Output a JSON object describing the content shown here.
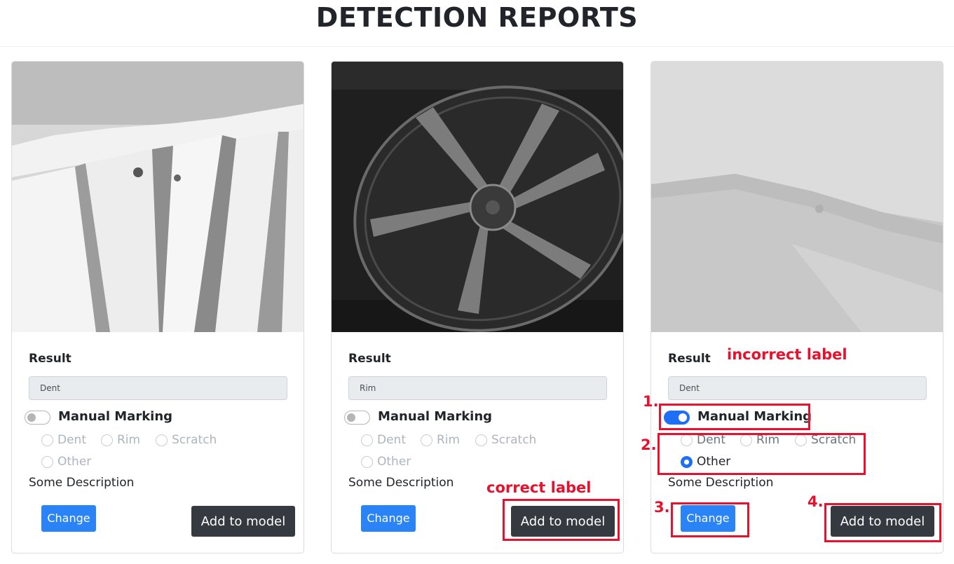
{
  "page": {
    "title": "DETECTION REPORTS"
  },
  "cards": [
    {
      "result_label": "Result",
      "result_value": "Dent",
      "manual_marking": "Manual Marking",
      "manual_on": false,
      "options": [
        "Dent",
        "Rim",
        "Scratch",
        "Other"
      ],
      "selected": null,
      "description": "Some Description",
      "change_label": "Change",
      "add_label": "Add to model"
    },
    {
      "result_label": "Result",
      "result_value": "Rim",
      "manual_marking": "Manual Marking",
      "manual_on": false,
      "options": [
        "Dent",
        "Rim",
        "Scratch",
        "Other"
      ],
      "selected": null,
      "description": "Some Description",
      "change_label": "Change",
      "add_label": "Add to model"
    },
    {
      "result_label": "Result",
      "result_value": "Dent",
      "manual_marking": "Manual Marking",
      "manual_on": true,
      "options": [
        "Dent",
        "Rim",
        "Scratch",
        "Other"
      ],
      "selected": "Other",
      "description": "Some Description",
      "change_label": "Change",
      "add_label": "Add to model"
    }
  ],
  "annotations": {
    "correct_label": "correct label",
    "incorrect_label": "incorrect label",
    "step1": "1.",
    "step2": "2.",
    "step3": "3.",
    "step4": "4."
  },
  "colors": {
    "annotation_red": "#e8112d",
    "switch_on": "#1e6ff6",
    "change_button": "#2a84f8",
    "add_button": "#343a40"
  }
}
